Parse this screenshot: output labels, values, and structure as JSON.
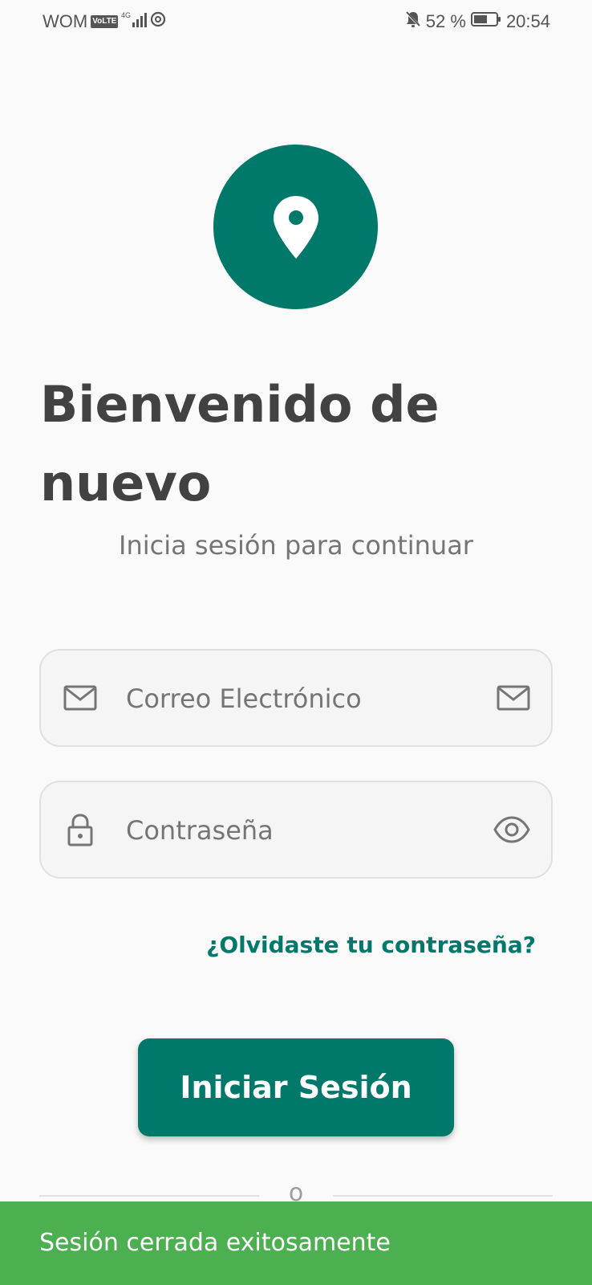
{
  "status_bar": {
    "carrier": "WOM",
    "volte": "VoLTE",
    "network": "4G",
    "battery": "52 %",
    "time": "20:54"
  },
  "welcome": {
    "title": "Bienvenido de nuevo",
    "subtitle": "Inicia sesión para continuar"
  },
  "form": {
    "email_placeholder": "Correo Electrónico",
    "password_placeholder": "Contraseña",
    "forgot_link": "¿Olvidaste tu contraseña?",
    "login_button": "Iniciar Sesión",
    "divider_text": "o"
  },
  "snackbar": {
    "message": "Sesión cerrada exitosamente"
  },
  "colors": {
    "primary": "#00796b",
    "snackbar": "#4caf50",
    "text_dark": "#424242",
    "text_muted": "#757575"
  },
  "icons": {
    "logo": "location-pin-icon",
    "email_lead": "envelope-icon",
    "email_trail": "envelope-icon",
    "password_lead": "lock-icon",
    "password_trail": "eye-icon"
  }
}
